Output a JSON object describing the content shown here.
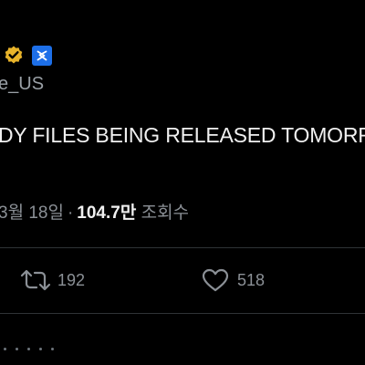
{
  "tweet": {
    "handle": "e_US",
    "text": "DY FILES BEING RELEASED TOMORR",
    "date": "3월 18일",
    "date_prefix": "",
    "separator": "·",
    "views_count": "104.7만",
    "views_label": "조회수",
    "badges": [
      "verified-gold-badge",
      "affiliate-badge"
    ]
  },
  "actions": {
    "retweet_count": "192",
    "like_count": "518"
  },
  "colors": {
    "background": "#000000",
    "text_primary": "#e7e9ea",
    "text_secondary": "#8b9096",
    "divider": "#2f3336",
    "gold": "#e8b32a",
    "affiliate_blue": "#1d6fe8"
  },
  "icons": {
    "verified": "verified-badge-icon",
    "affiliate": "affiliate-badge-icon",
    "retweet": "retweet-icon",
    "like": "heart-icon"
  }
}
